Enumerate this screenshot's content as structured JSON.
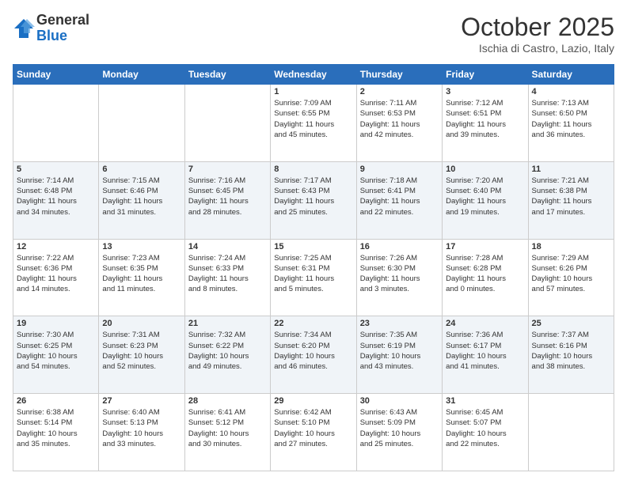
{
  "header": {
    "logo_line1": "General",
    "logo_line2": "Blue",
    "month": "October 2025",
    "location": "Ischia di Castro, Lazio, Italy"
  },
  "weekdays": [
    "Sunday",
    "Monday",
    "Tuesday",
    "Wednesday",
    "Thursday",
    "Friday",
    "Saturday"
  ],
  "weeks": [
    [
      {
        "day": null,
        "info": ""
      },
      {
        "day": null,
        "info": ""
      },
      {
        "day": null,
        "info": ""
      },
      {
        "day": "1",
        "info": "Sunrise: 7:09 AM\nSunset: 6:55 PM\nDaylight: 11 hours\nand 45 minutes."
      },
      {
        "day": "2",
        "info": "Sunrise: 7:11 AM\nSunset: 6:53 PM\nDaylight: 11 hours\nand 42 minutes."
      },
      {
        "day": "3",
        "info": "Sunrise: 7:12 AM\nSunset: 6:51 PM\nDaylight: 11 hours\nand 39 minutes."
      },
      {
        "day": "4",
        "info": "Sunrise: 7:13 AM\nSunset: 6:50 PM\nDaylight: 11 hours\nand 36 minutes."
      }
    ],
    [
      {
        "day": "5",
        "info": "Sunrise: 7:14 AM\nSunset: 6:48 PM\nDaylight: 11 hours\nand 34 minutes."
      },
      {
        "day": "6",
        "info": "Sunrise: 7:15 AM\nSunset: 6:46 PM\nDaylight: 11 hours\nand 31 minutes."
      },
      {
        "day": "7",
        "info": "Sunrise: 7:16 AM\nSunset: 6:45 PM\nDaylight: 11 hours\nand 28 minutes."
      },
      {
        "day": "8",
        "info": "Sunrise: 7:17 AM\nSunset: 6:43 PM\nDaylight: 11 hours\nand 25 minutes."
      },
      {
        "day": "9",
        "info": "Sunrise: 7:18 AM\nSunset: 6:41 PM\nDaylight: 11 hours\nand 22 minutes."
      },
      {
        "day": "10",
        "info": "Sunrise: 7:20 AM\nSunset: 6:40 PM\nDaylight: 11 hours\nand 19 minutes."
      },
      {
        "day": "11",
        "info": "Sunrise: 7:21 AM\nSunset: 6:38 PM\nDaylight: 11 hours\nand 17 minutes."
      }
    ],
    [
      {
        "day": "12",
        "info": "Sunrise: 7:22 AM\nSunset: 6:36 PM\nDaylight: 11 hours\nand 14 minutes."
      },
      {
        "day": "13",
        "info": "Sunrise: 7:23 AM\nSunset: 6:35 PM\nDaylight: 11 hours\nand 11 minutes."
      },
      {
        "day": "14",
        "info": "Sunrise: 7:24 AM\nSunset: 6:33 PM\nDaylight: 11 hours\nand 8 minutes."
      },
      {
        "day": "15",
        "info": "Sunrise: 7:25 AM\nSunset: 6:31 PM\nDaylight: 11 hours\nand 5 minutes."
      },
      {
        "day": "16",
        "info": "Sunrise: 7:26 AM\nSunset: 6:30 PM\nDaylight: 11 hours\nand 3 minutes."
      },
      {
        "day": "17",
        "info": "Sunrise: 7:28 AM\nSunset: 6:28 PM\nDaylight: 11 hours\nand 0 minutes."
      },
      {
        "day": "18",
        "info": "Sunrise: 7:29 AM\nSunset: 6:26 PM\nDaylight: 10 hours\nand 57 minutes."
      }
    ],
    [
      {
        "day": "19",
        "info": "Sunrise: 7:30 AM\nSunset: 6:25 PM\nDaylight: 10 hours\nand 54 minutes."
      },
      {
        "day": "20",
        "info": "Sunrise: 7:31 AM\nSunset: 6:23 PM\nDaylight: 10 hours\nand 52 minutes."
      },
      {
        "day": "21",
        "info": "Sunrise: 7:32 AM\nSunset: 6:22 PM\nDaylight: 10 hours\nand 49 minutes."
      },
      {
        "day": "22",
        "info": "Sunrise: 7:34 AM\nSunset: 6:20 PM\nDaylight: 10 hours\nand 46 minutes."
      },
      {
        "day": "23",
        "info": "Sunrise: 7:35 AM\nSunset: 6:19 PM\nDaylight: 10 hours\nand 43 minutes."
      },
      {
        "day": "24",
        "info": "Sunrise: 7:36 AM\nSunset: 6:17 PM\nDaylight: 10 hours\nand 41 minutes."
      },
      {
        "day": "25",
        "info": "Sunrise: 7:37 AM\nSunset: 6:16 PM\nDaylight: 10 hours\nand 38 minutes."
      }
    ],
    [
      {
        "day": "26",
        "info": "Sunrise: 6:38 AM\nSunset: 5:14 PM\nDaylight: 10 hours\nand 35 minutes."
      },
      {
        "day": "27",
        "info": "Sunrise: 6:40 AM\nSunset: 5:13 PM\nDaylight: 10 hours\nand 33 minutes."
      },
      {
        "day": "28",
        "info": "Sunrise: 6:41 AM\nSunset: 5:12 PM\nDaylight: 10 hours\nand 30 minutes."
      },
      {
        "day": "29",
        "info": "Sunrise: 6:42 AM\nSunset: 5:10 PM\nDaylight: 10 hours\nand 27 minutes."
      },
      {
        "day": "30",
        "info": "Sunrise: 6:43 AM\nSunset: 5:09 PM\nDaylight: 10 hours\nand 25 minutes."
      },
      {
        "day": "31",
        "info": "Sunrise: 6:45 AM\nSunset: 5:07 PM\nDaylight: 10 hours\nand 22 minutes."
      },
      {
        "day": null,
        "info": ""
      }
    ]
  ]
}
